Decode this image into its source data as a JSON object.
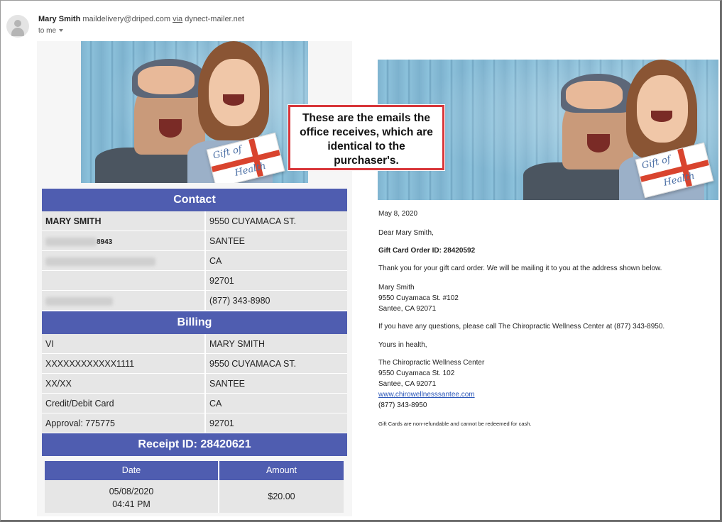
{
  "header": {
    "sender_name": "Mary Smith",
    "sender_email": "maildelivery@driped.com",
    "via_label": "via",
    "via_domain": "dynect-mailer.net",
    "recipient": "to me"
  },
  "banner": {
    "card_line1": "Gift of",
    "card_line2": "Health"
  },
  "contact": {
    "title": "Contact",
    "rows": [
      [
        "MARY SMITH",
        "9550 CUYAMACA ST."
      ],
      [
        "8943",
        "SANTEE"
      ],
      [
        "",
        "CA"
      ],
      [
        "",
        "92701"
      ],
      [
        "",
        "(877) 343-8980"
      ]
    ]
  },
  "billing": {
    "title": "Billing",
    "rows": [
      [
        "VI",
        "MARY SMITH"
      ],
      [
        "XXXXXXXXXXXX1111",
        "9550 CUYAMACA ST."
      ],
      [
        "XX/XX",
        "SANTEE"
      ],
      [
        "Credit/Debit Card",
        "CA"
      ],
      [
        "Approval: 775775",
        "92701"
      ]
    ]
  },
  "receipt": {
    "title": "Receipt ID: 28420621",
    "col_date": "Date",
    "col_amount": "Amount",
    "date": "05/08/2020",
    "time": "04:41 PM",
    "amount": "$20.00"
  },
  "callout": {
    "line1": "These are the emails the",
    "line2": "office receives, which are",
    "line3": "identical to the",
    "line4": "purchaser's."
  },
  "letter": {
    "date": "May 8, 2020",
    "greeting": "Dear Mary Smith,",
    "order_id": "Gift Card Order ID: 28420592",
    "thanks": "Thank you for your gift card order.  We will be mailing it to you at the address shown below.",
    "addr_name": "Mary Smith",
    "addr_street": "9550 Cuyamaca St. #102",
    "addr_city": "Santee, CA 92071",
    "questions": "If you have any questions, please call The Chiropractic Wellness Center at (877) 343-8950.",
    "closing": "Yours in health,",
    "org": "The Chiropractic Wellness Center",
    "org_street": "9550 Cuyamaca St. 102",
    "org_city": "Santee, CA 92071",
    "website": "www.chirowellnesssantee.com",
    "phone": "(877) 343-8950",
    "disclaimer": "Gift Cards are non-refundable and cannot be redeemed for cash."
  },
  "colors": {
    "band": "#4f5db0",
    "cell": "#e6e6e6",
    "callout_border": "#d8363a",
    "link": "#2a56b8"
  }
}
